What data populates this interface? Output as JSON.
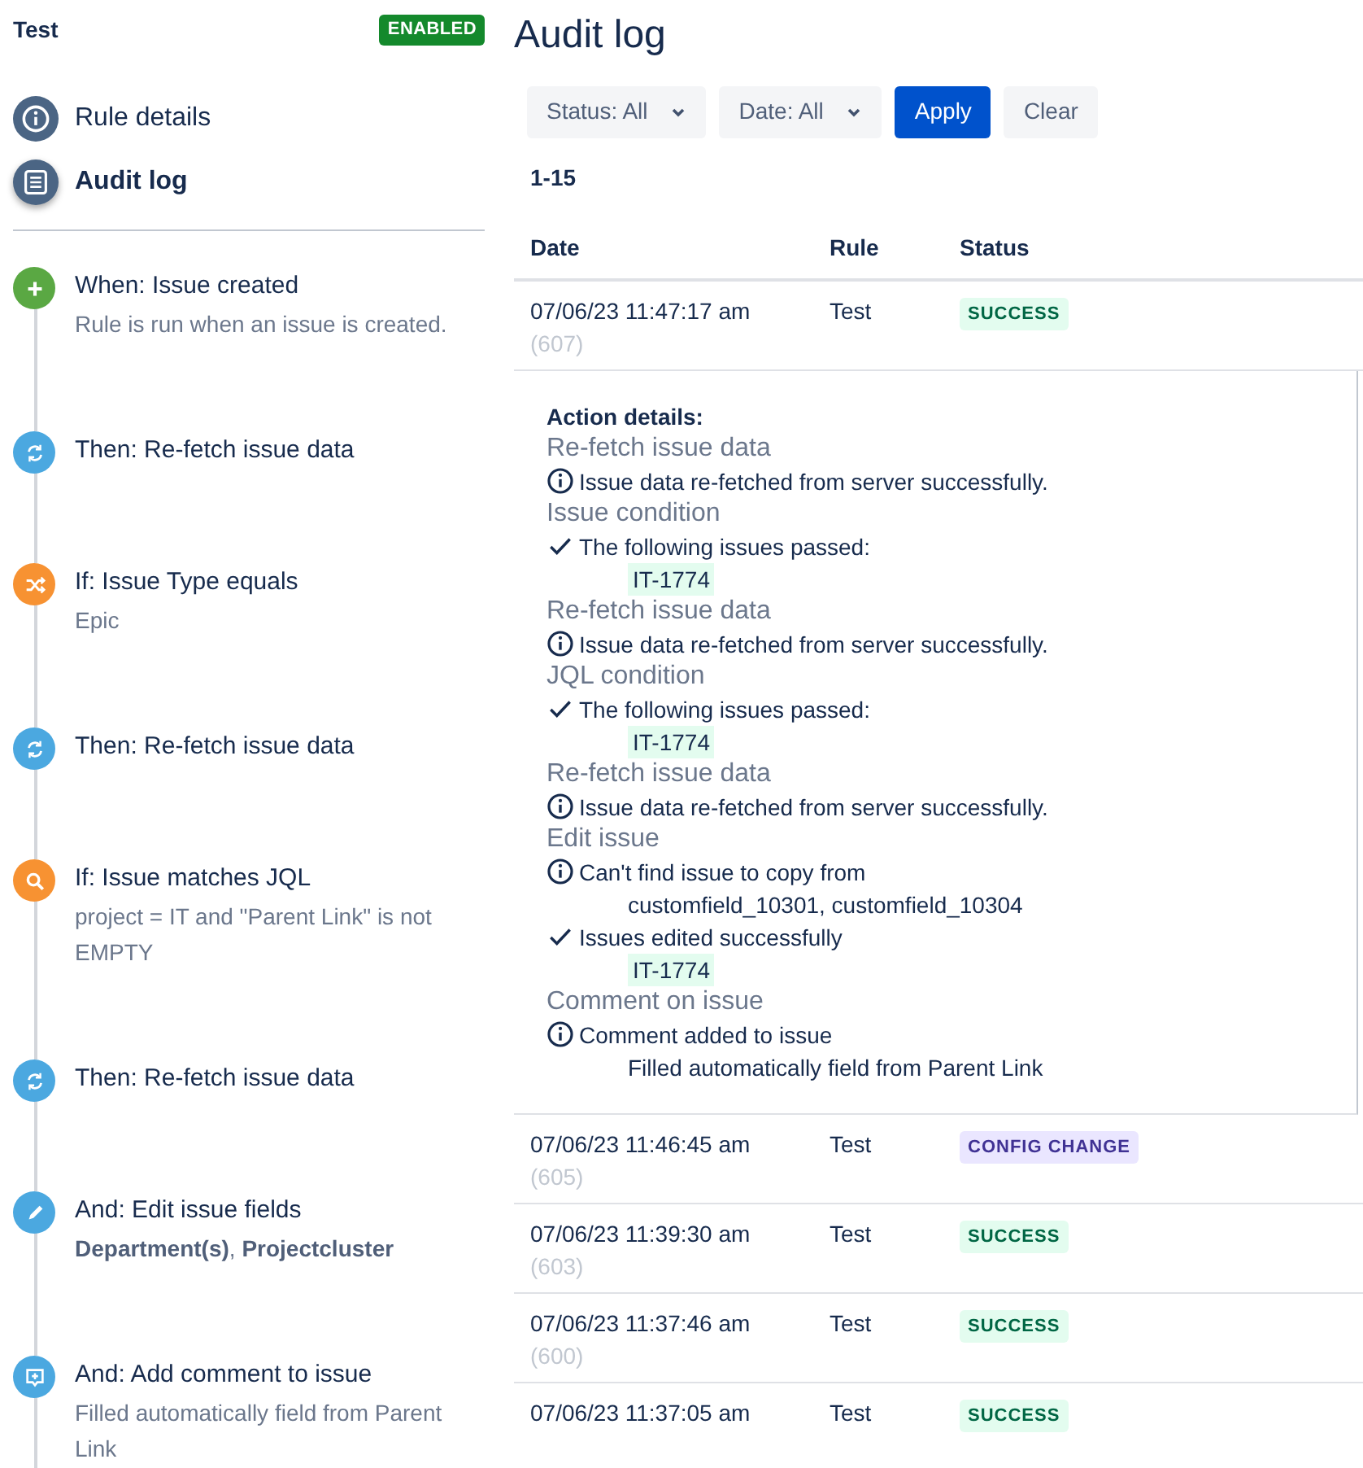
{
  "rule": {
    "name": "Test",
    "state_badge": "ENABLED"
  },
  "nav": [
    {
      "label": "Rule details",
      "kind": "info",
      "selected": false
    },
    {
      "label": "Audit log",
      "kind": "list",
      "selected": true
    }
  ],
  "steps": [
    {
      "kind": "create",
      "title": "When: Issue created",
      "subtitle": "Rule is run when an issue is created."
    },
    {
      "kind": "refetch",
      "title": "Then: Re-fetch issue data"
    },
    {
      "kind": "type-condition",
      "title": "If: Issue Type equals",
      "subtitle": "Epic"
    },
    {
      "kind": "refetch",
      "title": "Then: Re-fetch issue data"
    },
    {
      "kind": "jql-condition",
      "title": "If: Issue matches JQL",
      "subtitle": "project = IT and \"Parent Link\" is not EMPTY"
    },
    {
      "kind": "refetch",
      "title": "Then: Re-fetch issue data"
    },
    {
      "kind": "edit",
      "title": "And: Edit issue fields",
      "subtitle": "**Department(s)**, **Projectcluster**"
    },
    {
      "kind": "comment",
      "title": "And: Add comment to issue",
      "subtitle": "Filled automatically field from Parent Link"
    }
  ],
  "page_title": "Audit log",
  "filters": [
    {
      "label": "Status: All",
      "kind": "dropdown"
    },
    {
      "label": "Date: All",
      "kind": "dropdown"
    },
    {
      "label": "Apply",
      "kind": "primary"
    },
    {
      "label": "Clear",
      "kind": "plain"
    }
  ],
  "range": "1-15",
  "table": {
    "columns": [
      "Date",
      "Rule",
      "Status"
    ],
    "rows": [
      {
        "date": "07/06/23 11:47:17 am",
        "id": "(607)",
        "rule": "Test",
        "status": "SUCCESS",
        "kind": "success",
        "details": {
          "title": "Action details:",
          "entries": [
            {
              "heading": "Re-fetch issue data",
              "lines": [
                {
                  "kind": "info",
                  "text": "Issue data re-fetched from server successfully."
                }
              ]
            },
            {
              "heading": "Issue condition",
              "lines": [
                {
                  "kind": "check",
                  "text": "The following issues passed:",
                  "items": [
                    {
                      "kind": "issue",
                      "text": "IT-1774"
                    }
                  ]
                }
              ]
            },
            {
              "heading": "Re-fetch issue data",
              "lines": [
                {
                  "kind": "info",
                  "text": "Issue data re-fetched from server successfully."
                }
              ]
            },
            {
              "heading": "JQL condition",
              "lines": [
                {
                  "kind": "check",
                  "text": "The following issues passed:",
                  "items": [
                    {
                      "kind": "issue",
                      "text": "IT-1774"
                    }
                  ]
                }
              ]
            },
            {
              "heading": "Re-fetch issue data",
              "lines": [
                {
                  "kind": "info",
                  "text": "Issue data re-fetched from server successfully."
                }
              ]
            },
            {
              "heading": "Edit issue",
              "lines": [
                {
                  "kind": "info",
                  "text": "Can't find issue to copy from",
                  "items": [
                    {
                      "kind": "plain",
                      "text": "customfield_10301, customfield_10304"
                    }
                  ]
                },
                {
                  "kind": "check",
                  "text": "Issues edited successfully",
                  "items": [
                    {
                      "kind": "issue",
                      "text": "IT-1774"
                    }
                  ]
                }
              ]
            },
            {
              "heading": "Comment on issue",
              "lines": [
                {
                  "kind": "info",
                  "text": "Comment added to issue",
                  "items": [
                    {
                      "kind": "plain",
                      "text": "Filled automatically field from Parent Link"
                    }
                  ]
                }
              ]
            }
          ]
        }
      },
      {
        "date": "07/06/23 11:46:45 am",
        "id": "(605)",
        "rule": "Test",
        "status": "CONFIG CHANGE",
        "kind": "config"
      },
      {
        "date": "07/06/23 11:39:30 am",
        "id": "(603)",
        "rule": "Test",
        "status": "SUCCESS",
        "kind": "success"
      },
      {
        "date": "07/06/23 11:37:46 am",
        "id": "(600)",
        "rule": "Test",
        "status": "SUCCESS",
        "kind": "success"
      },
      {
        "date": "07/06/23 11:37:05 am",
        "rule": "Test",
        "status": "SUCCESS",
        "kind": "success"
      }
    ]
  }
}
